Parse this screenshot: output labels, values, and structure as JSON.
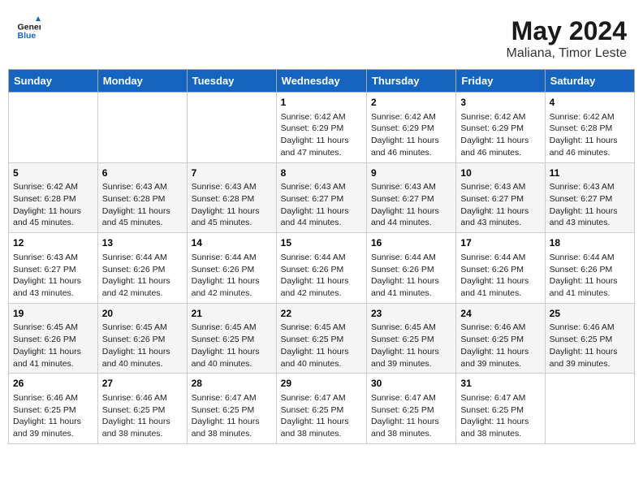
{
  "header": {
    "logo_line1": "General",
    "logo_line2": "Blue",
    "month_year": "May 2024",
    "location": "Maliana, Timor Leste"
  },
  "days_of_week": [
    "Sunday",
    "Monday",
    "Tuesday",
    "Wednesday",
    "Thursday",
    "Friday",
    "Saturday"
  ],
  "weeks": [
    [
      {
        "day": "",
        "info": ""
      },
      {
        "day": "",
        "info": ""
      },
      {
        "day": "",
        "info": ""
      },
      {
        "day": "1",
        "sunrise": "6:42 AM",
        "sunset": "6:29 PM",
        "daylight": "11 hours and 47 minutes."
      },
      {
        "day": "2",
        "sunrise": "6:42 AM",
        "sunset": "6:29 PM",
        "daylight": "11 hours and 46 minutes."
      },
      {
        "day": "3",
        "sunrise": "6:42 AM",
        "sunset": "6:29 PM",
        "daylight": "11 hours and 46 minutes."
      },
      {
        "day": "4",
        "sunrise": "6:42 AM",
        "sunset": "6:28 PM",
        "daylight": "11 hours and 46 minutes."
      }
    ],
    [
      {
        "day": "5",
        "sunrise": "6:42 AM",
        "sunset": "6:28 PM",
        "daylight": "11 hours and 45 minutes."
      },
      {
        "day": "6",
        "sunrise": "6:43 AM",
        "sunset": "6:28 PM",
        "daylight": "11 hours and 45 minutes."
      },
      {
        "day": "7",
        "sunrise": "6:43 AM",
        "sunset": "6:28 PM",
        "daylight": "11 hours and 45 minutes."
      },
      {
        "day": "8",
        "sunrise": "6:43 AM",
        "sunset": "6:27 PM",
        "daylight": "11 hours and 44 minutes."
      },
      {
        "day": "9",
        "sunrise": "6:43 AM",
        "sunset": "6:27 PM",
        "daylight": "11 hours and 44 minutes."
      },
      {
        "day": "10",
        "sunrise": "6:43 AM",
        "sunset": "6:27 PM",
        "daylight": "11 hours and 43 minutes."
      },
      {
        "day": "11",
        "sunrise": "6:43 AM",
        "sunset": "6:27 PM",
        "daylight": "11 hours and 43 minutes."
      }
    ],
    [
      {
        "day": "12",
        "sunrise": "6:43 AM",
        "sunset": "6:27 PM",
        "daylight": "11 hours and 43 minutes."
      },
      {
        "day": "13",
        "sunrise": "6:44 AM",
        "sunset": "6:26 PM",
        "daylight": "11 hours and 42 minutes."
      },
      {
        "day": "14",
        "sunrise": "6:44 AM",
        "sunset": "6:26 PM",
        "daylight": "11 hours and 42 minutes."
      },
      {
        "day": "15",
        "sunrise": "6:44 AM",
        "sunset": "6:26 PM",
        "daylight": "11 hours and 42 minutes."
      },
      {
        "day": "16",
        "sunrise": "6:44 AM",
        "sunset": "6:26 PM",
        "daylight": "11 hours and 41 minutes."
      },
      {
        "day": "17",
        "sunrise": "6:44 AM",
        "sunset": "6:26 PM",
        "daylight": "11 hours and 41 minutes."
      },
      {
        "day": "18",
        "sunrise": "6:44 AM",
        "sunset": "6:26 PM",
        "daylight": "11 hours and 41 minutes."
      }
    ],
    [
      {
        "day": "19",
        "sunrise": "6:45 AM",
        "sunset": "6:26 PM",
        "daylight": "11 hours and 41 minutes."
      },
      {
        "day": "20",
        "sunrise": "6:45 AM",
        "sunset": "6:26 PM",
        "daylight": "11 hours and 40 minutes."
      },
      {
        "day": "21",
        "sunrise": "6:45 AM",
        "sunset": "6:25 PM",
        "daylight": "11 hours and 40 minutes."
      },
      {
        "day": "22",
        "sunrise": "6:45 AM",
        "sunset": "6:25 PM",
        "daylight": "11 hours and 40 minutes."
      },
      {
        "day": "23",
        "sunrise": "6:45 AM",
        "sunset": "6:25 PM",
        "daylight": "11 hours and 39 minutes."
      },
      {
        "day": "24",
        "sunrise": "6:46 AM",
        "sunset": "6:25 PM",
        "daylight": "11 hours and 39 minutes."
      },
      {
        "day": "25",
        "sunrise": "6:46 AM",
        "sunset": "6:25 PM",
        "daylight": "11 hours and 39 minutes."
      }
    ],
    [
      {
        "day": "26",
        "sunrise": "6:46 AM",
        "sunset": "6:25 PM",
        "daylight": "11 hours and 39 minutes."
      },
      {
        "day": "27",
        "sunrise": "6:46 AM",
        "sunset": "6:25 PM",
        "daylight": "11 hours and 38 minutes."
      },
      {
        "day": "28",
        "sunrise": "6:47 AM",
        "sunset": "6:25 PM",
        "daylight": "11 hours and 38 minutes."
      },
      {
        "day": "29",
        "sunrise": "6:47 AM",
        "sunset": "6:25 PM",
        "daylight": "11 hours and 38 minutes."
      },
      {
        "day": "30",
        "sunrise": "6:47 AM",
        "sunset": "6:25 PM",
        "daylight": "11 hours and 38 minutes."
      },
      {
        "day": "31",
        "sunrise": "6:47 AM",
        "sunset": "6:25 PM",
        "daylight": "11 hours and 38 minutes."
      },
      {
        "day": "",
        "info": ""
      }
    ]
  ]
}
